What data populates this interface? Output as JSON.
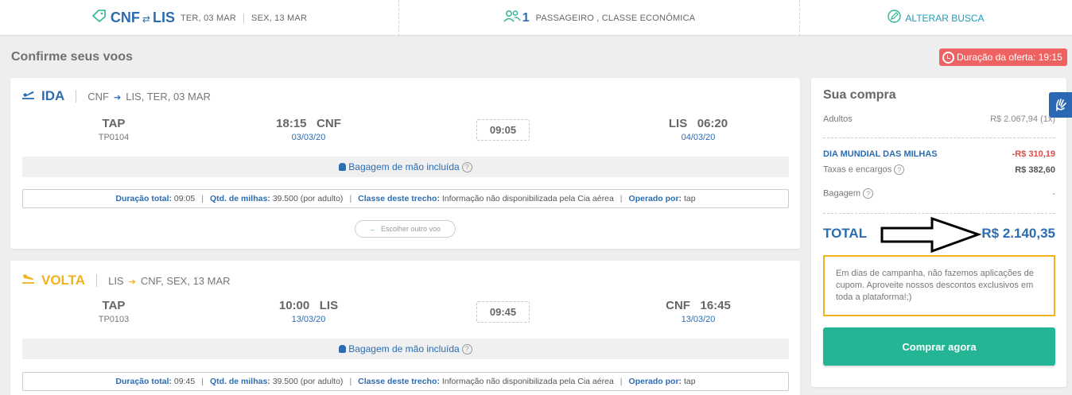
{
  "topbar": {
    "origin": "CNF",
    "destination": "LIS",
    "route_arrows": "⇄",
    "date_out": "TER, 03 MAR",
    "date_back": "SEX, 13 MAR",
    "passenger_count": "1",
    "passenger_text": "PASSAGEIRO , CLASSE ECONÔMICA",
    "change_search": "ALTERAR BUSCA"
  },
  "page_title": "Confirme seus voos",
  "offer_timer": "Duração da oferta: 19:15",
  "flights": [
    {
      "direction": "IDA",
      "origin": "CNF",
      "route_rest": "LIS, TER, 03 MAR",
      "airline": "TAP",
      "flight_code": "TP0104",
      "dep_time": "18:15",
      "dep_airport": "CNF",
      "dep_date": "03/03/20",
      "duration": "09:05",
      "arr_airport": "LIS",
      "arr_time": "06:20",
      "arr_date": "04/03/20",
      "baggage": "Bagagem de mão incluída",
      "details": {
        "total_label": "Duração total:",
        "total_value": "09:05",
        "miles_label": "Qtd. de milhas:",
        "miles_value": "39.500 (por adulto)",
        "class_label": "Classe deste trecho:",
        "class_value": "Informação não disponibilizada pela Cia aérea",
        "operated_label": "Operado por:",
        "operated_value": "tap"
      },
      "choose_other": "Escolher outro voo"
    },
    {
      "direction": "VOLTA",
      "origin": "LIS",
      "route_rest": "CNF, SEX, 13 MAR",
      "airline": "TAP",
      "flight_code": "TP0103",
      "dep_time": "10:00",
      "dep_airport": "LIS",
      "dep_date": "13/03/20",
      "duration": "09:45",
      "arr_airport": "CNF",
      "arr_time": "16:45",
      "arr_date": "13/03/20",
      "baggage": "Bagagem de mão incluída",
      "details": {
        "total_label": "Duração total:",
        "total_value": "09:45",
        "miles_label": "Qtd. de milhas:",
        "miles_value": "39.500 (por adulto)",
        "class_label": "Classe deste trecho:",
        "class_value": "Informação não disponibilizada pela Cia aérea",
        "operated_label": "Operado por:",
        "operated_value": "tap"
      }
    }
  ],
  "purchase": {
    "title": "Sua compra",
    "adults_label": "Adultos",
    "adults_value": "R$ 2.067,94 (1x)",
    "discount_label": "DIA MUNDIAL DAS MILHAS",
    "discount_value": "-R$ 310,19",
    "taxes_label": "Taxas e encargos",
    "taxes_value": "R$ 382,60",
    "baggage_label": "Bagagem",
    "baggage_value": "-",
    "total_label": "TOTAL",
    "total_value": "R$ 2.140,35",
    "notice": "Em dias de campanha, não fazemos aplicações de cupom. Aproveite nossos descontos exclusivos em toda a plataforma!;)",
    "buy_button": "Comprar agora"
  },
  "colors": {
    "brand_blue": "#2c6cb0",
    "volta_yellow": "#f2b21f",
    "buy_green": "#24b594",
    "offer_red": "#ef6262",
    "discount_red": "#e04b4b"
  },
  "icons": {
    "ticket": "ticket-icon",
    "passenger": "passenger-icon",
    "edit": "edit-icon",
    "clock": "clock-icon",
    "plane_out": "plane-departure-icon",
    "plane_back": "plane-arrival-icon",
    "baggage": "backpack-icon",
    "help": "help-icon",
    "accessibility": "sign-language-icon",
    "annotation_arrow": "annotation-arrow-icon"
  }
}
